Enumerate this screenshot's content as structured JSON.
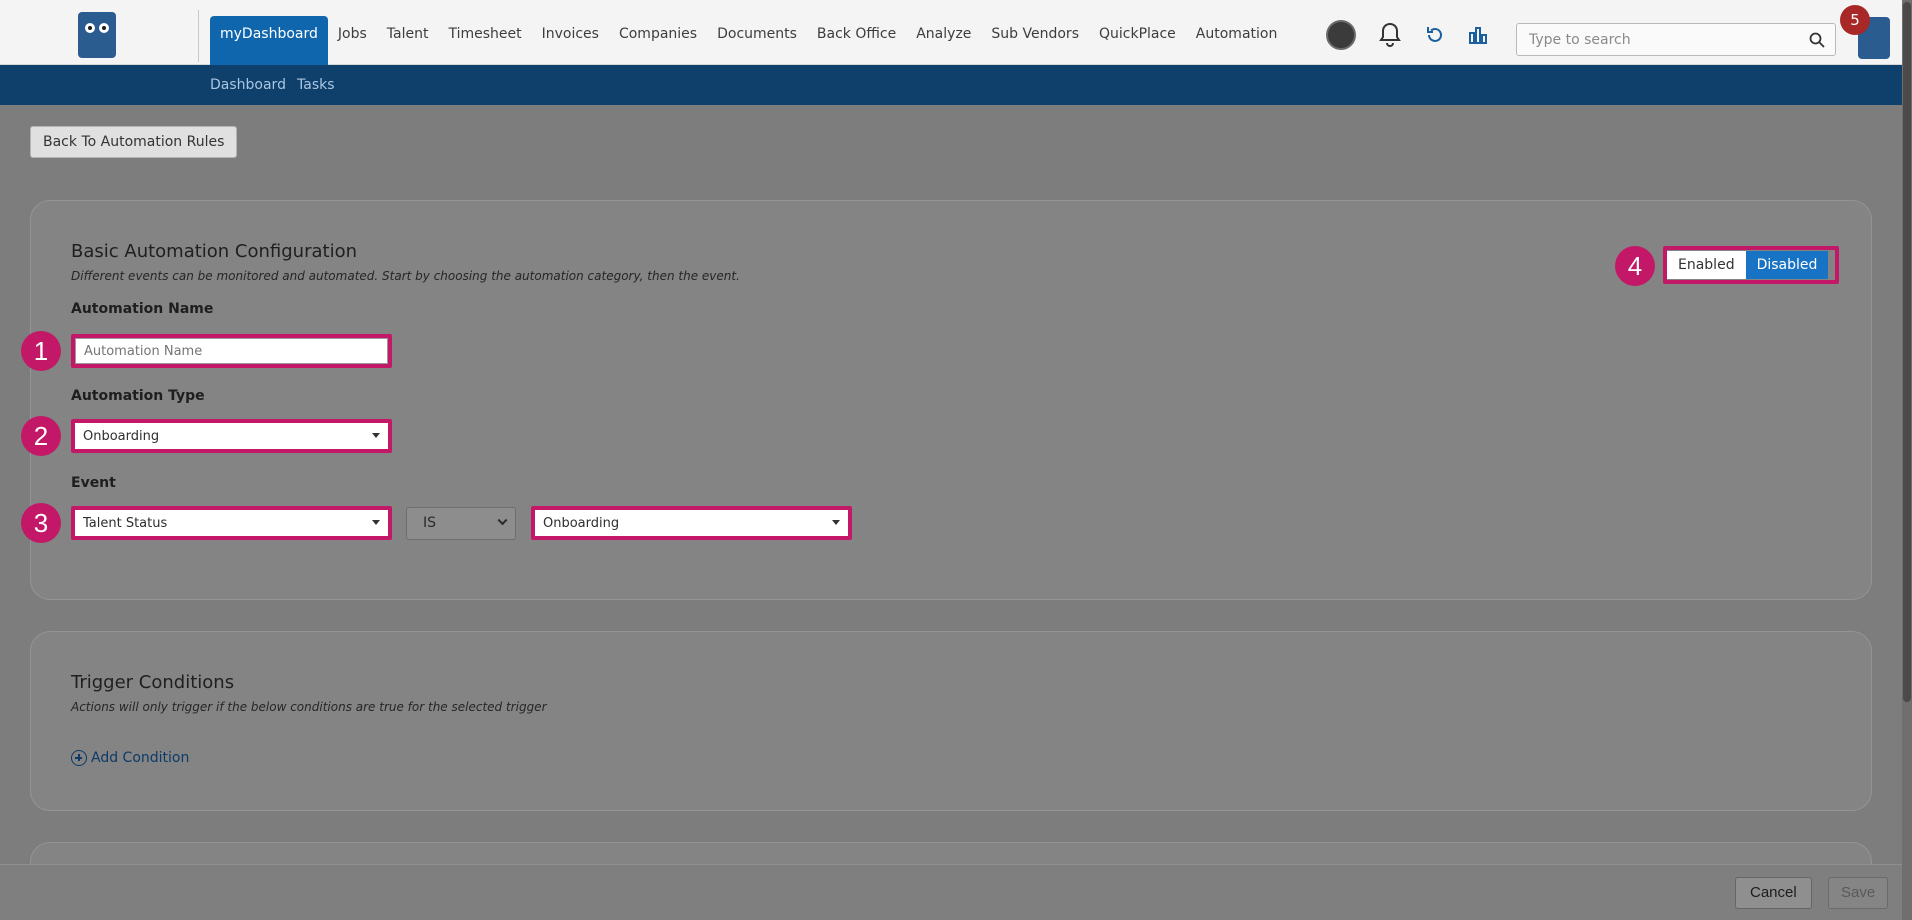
{
  "nav": {
    "items": [
      {
        "label": "myDashboard",
        "active": true
      },
      {
        "label": "Jobs"
      },
      {
        "label": "Talent"
      },
      {
        "label": "Timesheet"
      },
      {
        "label": "Invoices"
      },
      {
        "label": "Companies"
      },
      {
        "label": "Documents"
      },
      {
        "label": "Back Office"
      },
      {
        "label": "Analyze"
      },
      {
        "label": "Sub Vendors"
      },
      {
        "label": "QuickPlace"
      },
      {
        "label": "Automation"
      }
    ],
    "search_placeholder": "Type to search",
    "notification_count": "5",
    "icons": [
      "avatar",
      "bell-icon",
      "refresh-icon",
      "bar-chart-icon",
      "search-icon"
    ]
  },
  "subnav": {
    "items": [
      "Dashboard",
      "Tasks"
    ]
  },
  "back_button": "Back To Automation Rules",
  "basic_config": {
    "title": "Basic Automation Configuration",
    "subtitle": "Different events can be monitored and automated. Start by choosing the automation category, then the event.",
    "name_label": "Automation Name",
    "name_placeholder": "Automation Name",
    "type_label": "Automation Type",
    "type_value": "Onboarding",
    "event_label": "Event",
    "event_field_value": "Talent Status",
    "event_operator": "IS",
    "event_target_value": "Onboarding",
    "toggle": {
      "enabled_label": "Enabled",
      "disabled_label": "Disabled",
      "selected": "Disabled"
    }
  },
  "trigger_conditions": {
    "title": "Trigger Conditions",
    "subtitle": "Actions will only trigger if the below conditions are true for the selected trigger",
    "add_label": "Add Condition"
  },
  "markers": [
    "1",
    "2",
    "3",
    "4"
  ],
  "footer": {
    "cancel": "Cancel",
    "save": "Save"
  },
  "colors": {
    "primary": "#0f66ad",
    "subnav": "#0f3f6b",
    "highlight": "#c21867",
    "toggle_active": "#1873c4"
  }
}
